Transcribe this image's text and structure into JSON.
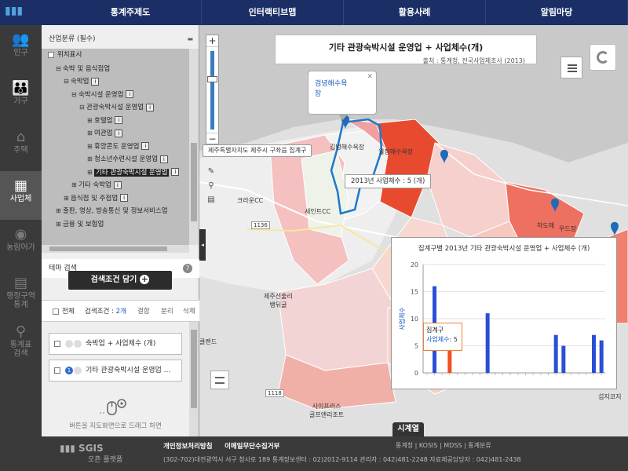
{
  "nav": [
    "통계주제도",
    "인터랙티브맵",
    "활용사례",
    "알림마당"
  ],
  "sidebar": [
    {
      "label": "인구",
      "icon": "people-icon"
    },
    {
      "label": "가구",
      "icon": "family-icon"
    },
    {
      "label": "주택",
      "icon": "house-icon"
    },
    {
      "label": "사업체",
      "icon": "building-icon"
    },
    {
      "label": "농림어가",
      "icon": "pig-icon"
    },
    {
      "label": "행정구역\n통계",
      "icon": "map-book-icon"
    },
    {
      "label": "통계표\n검색",
      "icon": "search-doc-icon"
    }
  ],
  "panel": {
    "tree_title": "산업분류 (필수)",
    "tree": [
      {
        "label": "위치표시",
        "indent": 0,
        "toggle": "",
        "cb": true,
        "info": false
      },
      {
        "label": "숙박 및 음식점업",
        "indent": 1,
        "toggle": "⊟",
        "info": false
      },
      {
        "label": "숙박업",
        "indent": 2,
        "toggle": "⊟",
        "info": true
      },
      {
        "label": "숙박시설 운영업",
        "indent": 3,
        "toggle": "⊟",
        "info": true
      },
      {
        "label": "관광숙박시설 운영업",
        "indent": 4,
        "toggle": "⊟",
        "info": true
      },
      {
        "label": "호텔업",
        "indent": 5,
        "toggle": "⊞",
        "info": true
      },
      {
        "label": "여관업",
        "indent": 5,
        "toggle": "⊞",
        "info": true
      },
      {
        "label": "휴양콘도 운영업",
        "indent": 5,
        "toggle": "⊞",
        "info": true
      },
      {
        "label": "청소년수련시설 운영업",
        "indent": 5,
        "toggle": "⊞",
        "info": true
      },
      {
        "label": "기타 관광숙박시설 운영업",
        "indent": 5,
        "toggle": "⊞",
        "info": true,
        "selected": true
      },
      {
        "label": "기타 숙박업",
        "indent": 3,
        "toggle": "⊞",
        "info": true
      },
      {
        "label": "음식점 및 주점업",
        "indent": 2,
        "toggle": "⊞",
        "info": true
      },
      {
        "label": "출판, 영상, 방송통신 및 정보서비스업",
        "indent": 1,
        "toggle": "⊞",
        "info": false
      },
      {
        "label": "금융 및 보험업",
        "indent": 1,
        "toggle": "⊞",
        "info": false
      }
    ],
    "theme_label": "테마 검색",
    "search_button": "검색조건 담기",
    "cond_all": "전체",
    "cond_label": "검색조건 : ",
    "cond_count": "2개",
    "ops": [
      "결합",
      "분리",
      "삭제"
    ],
    "conditions": [
      {
        "text": "숙박업 + 사업체수 (개)",
        "num": ""
      },
      {
        "text": "기타 관광숙박시설 운영업 …",
        "num": "1"
      }
    ],
    "drag_hint": "버튼을 지도화면으로 드래그 하면"
  },
  "map": {
    "title": "기타 관광숙박시설 운영업 + 사업체수(개)",
    "source": "출처 : 통계청, 전국사업체조사 (2013)",
    "popup": "검녕해수욕\n장",
    "sig_tip": "제주특별자치도 제주시 구좌읍 집계구",
    "count_tip": "2013년 사업체수 : 5 (개)",
    "labels": [
      {
        "t": "김녕해수욕장"
      },
      {
        "t": "월정해수욕장"
      },
      {
        "t": "크라운CC"
      },
      {
        "t": "세인트CC"
      },
      {
        "t": "제주선출리\n뱅뒤굴"
      },
      {
        "t": "하도해"
      },
      {
        "t": "우드장"
      },
      {
        "t": "사이프러스\n골프앤리조트"
      },
      {
        "t": "클랜드"
      },
      {
        "t": "섭지코지"
      },
      {
        "t": "1136"
      },
      {
        "t": "1118"
      }
    ],
    "timeline": "시계열"
  },
  "chart_data": {
    "type": "bar",
    "title": "집계구별 2013년 기타 관광숙박시설 운영업 + 사업체수 (개)",
    "ylabel": "사업체수",
    "ylim": [
      0,
      20
    ],
    "yticks": [
      0,
      5,
      10,
      15,
      20
    ],
    "values": [
      0,
      16,
      0,
      5,
      0,
      0,
      0,
      0,
      11,
      0,
      0,
      0,
      0,
      0,
      0,
      0,
      0,
      7,
      5,
      0,
      0,
      0,
      7,
      6
    ],
    "highlight_index": 3,
    "colors": {
      "bar": "#2a4fd6",
      "highlight": "#f0501e"
    },
    "tooltip_key": "집계구",
    "tooltip_val_label": "사업체수",
    "tooltip_val": "5"
  },
  "footer": {
    "logo": "SGIS",
    "logo_sub": "오픈 플랫폼",
    "links": [
      "개인정보처리방침",
      "이메일무단수집거부"
    ],
    "address": "(302-702)대전광역시 서구 청사로 189     통계정보센터 : 02)2012-9114     관리자 : 042)481-2248     자료제공담당자 : 042)481-2438",
    "right_links": "통계청 | KOSIS | MDSS | 통계분류"
  }
}
